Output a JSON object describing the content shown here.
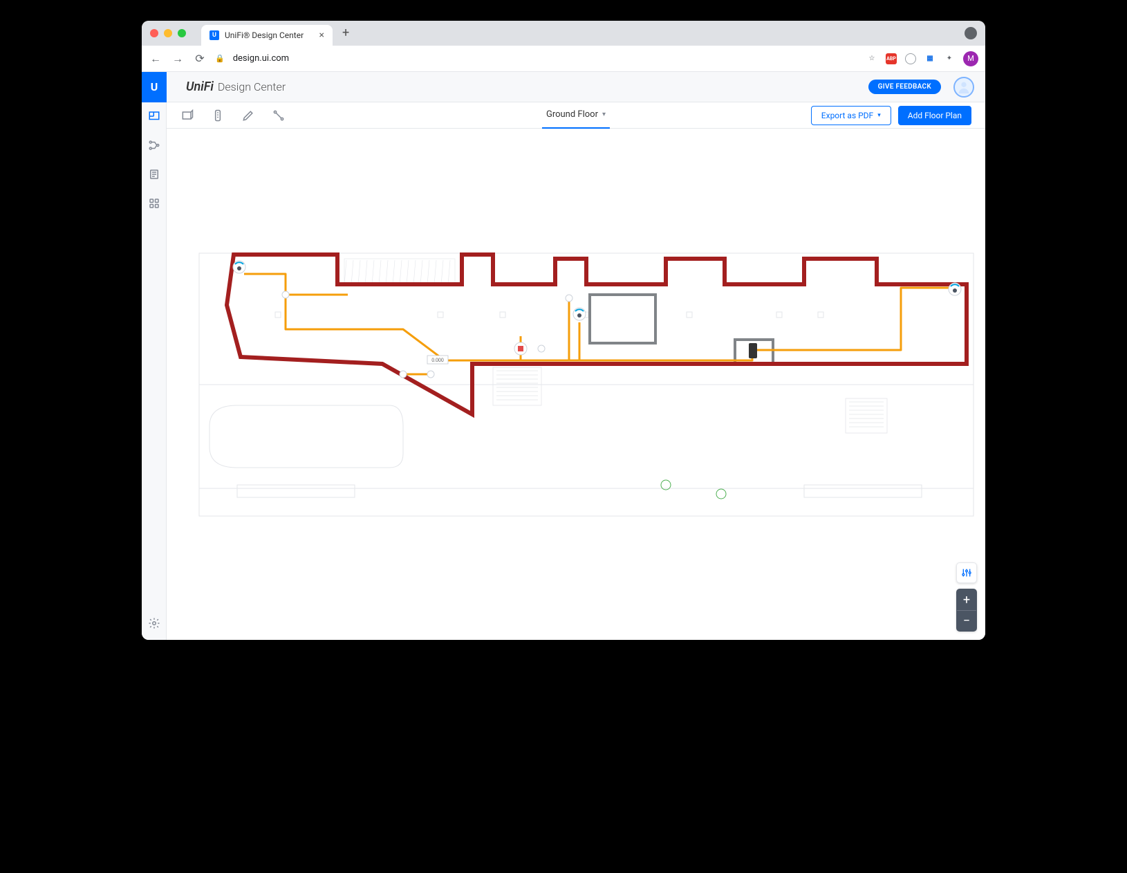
{
  "browser": {
    "tab_title": "UniFi® Design Center",
    "url_display": "design.ui.com",
    "favicon_letter": "U",
    "avatar_letter": "M"
  },
  "header": {
    "brand_main": "UniFi",
    "brand_sub": "Design Center",
    "feedback_label": "GIVE FEEDBACK"
  },
  "toolbar": {
    "floor_label": "Ground Floor",
    "export_label": "Export as PDF",
    "add_floor_label": "Add Floor Plan"
  },
  "floorplan": {
    "annotation_label": "0.000",
    "colors": {
      "wall": "#a31f1f",
      "cable": "#f59e0b",
      "background_lines": "#c4c8cf"
    }
  },
  "controls": {
    "zoom_in": "+",
    "zoom_out": "−"
  }
}
